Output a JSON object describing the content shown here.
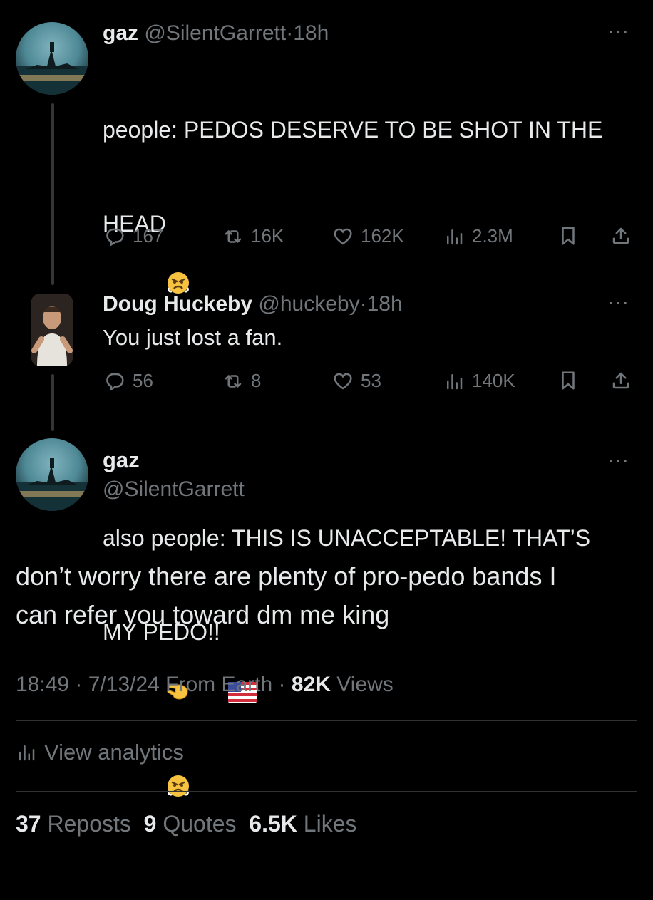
{
  "tweet1": {
    "name": "gaz",
    "handle": "@SilentGarrett",
    "sep": "·",
    "time": "18h",
    "more": "···",
    "text_line1": "people: PEDOS DESERVE TO BE SHOT IN THE",
    "text_line2": "HEAD",
    "text_line3": "also people: THIS IS UNACCEPTABLE! THAT’S",
    "text_line4": "MY PEDO!!",
    "replies": "167",
    "reposts": "16K",
    "likes": "162K",
    "views": "2.3M"
  },
  "tweet2": {
    "name": "Doug Huckeby",
    "handle": "@huckeby",
    "sep": "·",
    "time": "18h",
    "more": "···",
    "text": "You just lost a fan.",
    "replies": "56",
    "reposts": "8",
    "likes": "53",
    "views": "140K"
  },
  "main": {
    "name": "gaz",
    "handle": "@SilentGarrett",
    "more": "···",
    "text_line1": "don’t worry there are plenty of pro-pedo bands I",
    "text_line2": "can refer you toward dm me king",
    "timestamp": "18:49 · 7/13/24 From Earth",
    "sep": "·",
    "views_count": "82K",
    "views_label": "Views",
    "analytics_label": "View analytics",
    "reposts_count": "37",
    "reposts_label": "Reposts",
    "quotes_count": "9",
    "quotes_label": "Quotes",
    "likes_count": "6.5K",
    "likes_label": "Likes"
  },
  "colors": {
    "background": "#000000",
    "text": "#e7e9ea",
    "muted": "#71767b",
    "divider": "#2f3336"
  },
  "icons": [
    "reply-icon",
    "repost-icon",
    "like-icon",
    "views-icon",
    "bookmark-icon",
    "share-icon",
    "more-icon",
    "analytics-icon"
  ]
}
